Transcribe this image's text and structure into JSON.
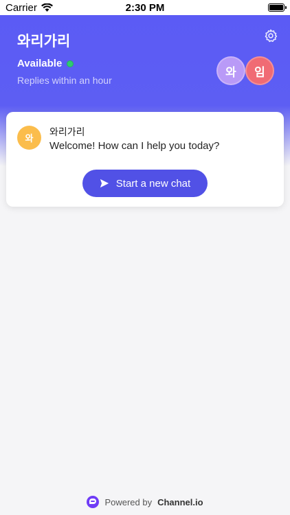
{
  "status_bar": {
    "carrier": "Carrier",
    "time": "2:30 PM",
    "icons": [
      "wifi-icon",
      "battery-icon"
    ]
  },
  "header": {
    "channel_name": "와리가리",
    "availability": "Available",
    "reply_time": "Replies within an hour",
    "settings_icon": "gear-icon",
    "avatars": [
      {
        "initial": "와",
        "color": "#b99af7"
      },
      {
        "initial": "임",
        "color": "#f06b74"
      }
    ]
  },
  "card": {
    "avatar_initial": "와",
    "avatar_color": "#fbbd4c",
    "sender": "와리가리",
    "message": "Welcome! How can I help you today?",
    "button_label": "Start a new chat",
    "button_icon": "send-icon"
  },
  "footer": {
    "prefix": "Powered by",
    "brand": "Channel.io",
    "logo_icon": "channel-logo-icon"
  },
  "colors": {
    "accent": "#5151e6",
    "header_bg": "#5b5bf5",
    "online": "#2ecc71"
  }
}
